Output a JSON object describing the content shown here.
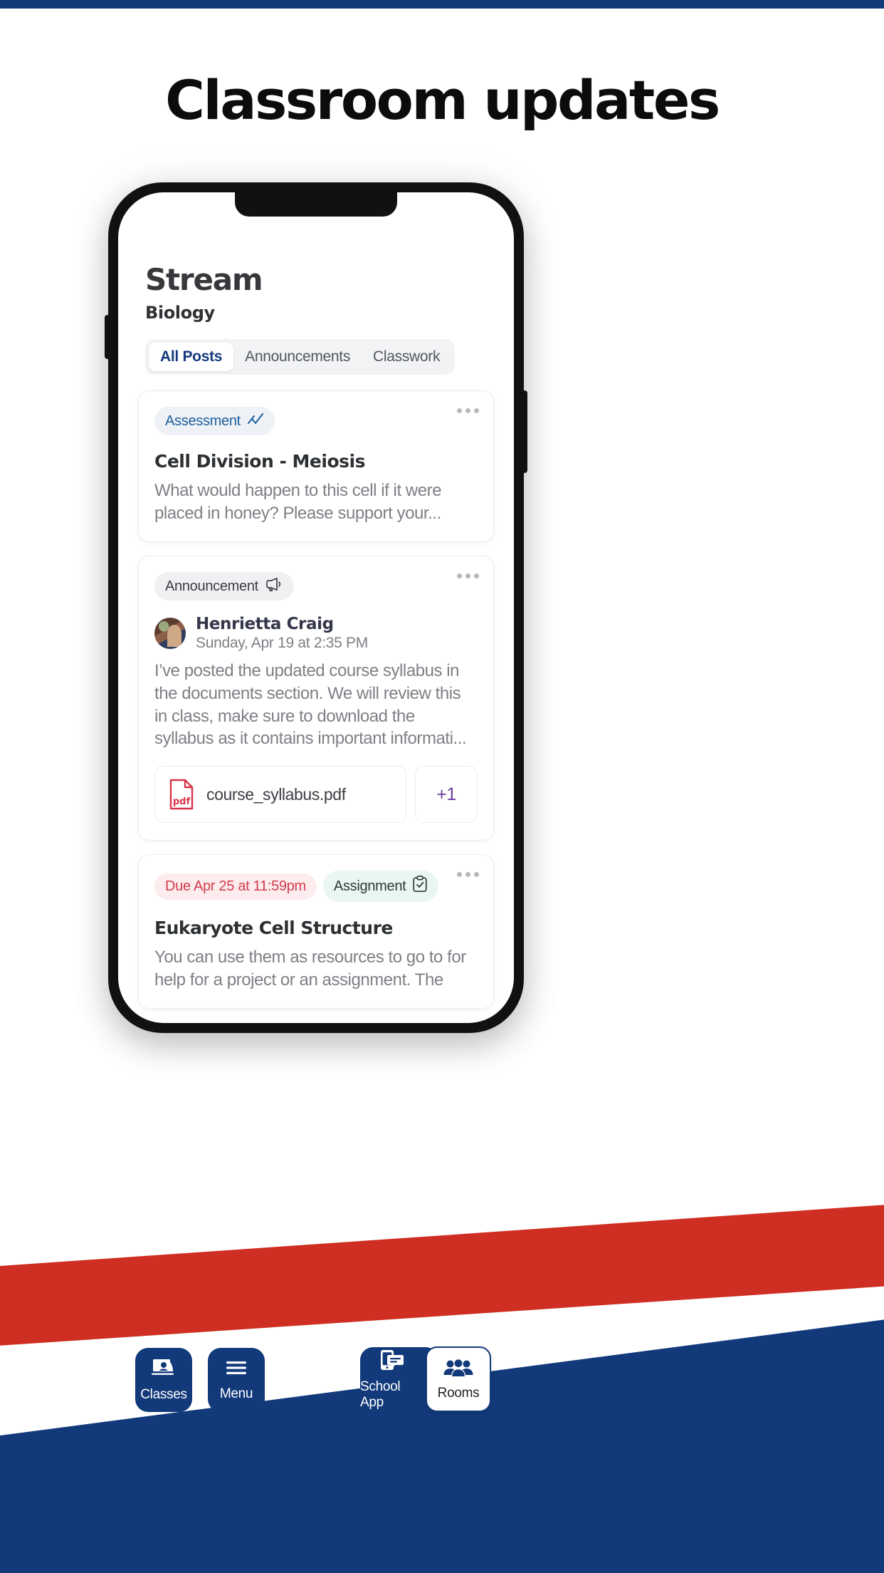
{
  "page": {
    "headline": "Classroom updates",
    "accent_navy": "#123a7a",
    "accent_red": "#cf2e22"
  },
  "app": {
    "title": "Stream",
    "subtitle": "Biology",
    "tabs": [
      {
        "label": "All Posts",
        "active": true
      },
      {
        "label": "Announcements",
        "active": false
      },
      {
        "label": "Classwork",
        "active": false
      }
    ]
  },
  "feed": {
    "cards": [
      {
        "badge": "Assessment",
        "badge_icon": "trend-chart-icon",
        "title": "Cell Division - Meiosis",
        "body": "What would happen to this cell if it were placed in honey? Please support your...",
        "menu_icon": "kebab-menu-icon"
      },
      {
        "badge": "Announcement",
        "badge_icon": "megaphone-icon",
        "author": "Henrietta Craig",
        "timestamp": "Sunday, Apr 19 at 2:35 PM",
        "body": "I’ve posted the updated course syllabus in the documents section. We will review this in class, make sure to download the syllabus as it contains important informati...",
        "attachment": {
          "filename": "course_syllabus.pdf",
          "icon": "pdf-file-icon",
          "icon_color": "#d8334a",
          "more_label": "+1",
          "more_color": "#6b3fa0"
        },
        "menu_icon": "kebab-menu-icon"
      },
      {
        "due_badge": "Due Apr 25 at 11:59pm",
        "badge": "Assignment",
        "badge_icon": "clipboard-check-icon",
        "title": "Eukaryote Cell Structure",
        "body": "You can use them as resources to go to for help for a project or an assignment. The",
        "menu_icon": "kebab-menu-icon"
      }
    ]
  },
  "bottom_nav": {
    "items": [
      {
        "label": "Classes",
        "icon": "classroom-board-icon",
        "active": false
      },
      {
        "label": "Menu",
        "icon": "hamburger-menu-icon",
        "active": false
      },
      {
        "label": "School App",
        "icon": "phone-chat-icon",
        "active": false
      },
      {
        "label": "Rooms",
        "icon": "people-group-icon",
        "active": true
      }
    ]
  }
}
